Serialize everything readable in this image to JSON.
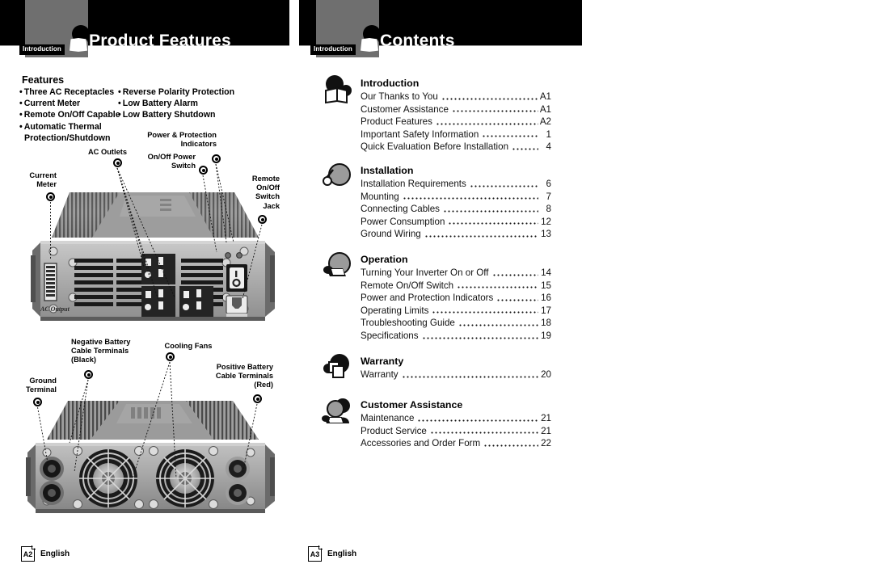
{
  "document": {
    "title": "Product Features / Contents",
    "language": "English"
  },
  "left_page": {
    "header": {
      "tab_label": "Introduction",
      "title": "Product Features",
      "icon": "reader-book-icon"
    },
    "features": {
      "heading": "Features",
      "column_one": [
        "Three AC Receptacles",
        "Current Meter",
        "Remote On/Off Capable",
        "Automatic Thermal"
      ],
      "column_one_continuation": "Protection/Shutdown",
      "column_two": [
        "Reverse Polarity Protection",
        "Low Battery Alarm",
        "Low Battery Shutdown"
      ]
    },
    "front_photo": {
      "caption_alt": "Inverter front panel",
      "panel_label": "AC Output",
      "callouts": [
        {
          "name": "current-meter",
          "lines": [
            "Current",
            "Meter"
          ]
        },
        {
          "name": "ac-outlets",
          "lines": [
            "AC Outlets"
          ]
        },
        {
          "name": "on-off-power-switch",
          "lines": [
            "On/Off Power",
            "Switch"
          ]
        },
        {
          "name": "power-protection-indicators",
          "lines": [
            "Power & Protection",
            "Indicators"
          ]
        },
        {
          "name": "remote-on-off-switch-jack",
          "lines": [
            "Remote",
            "On/Off",
            "Switch",
            "Jack"
          ]
        }
      ]
    },
    "rear_photo": {
      "caption_alt": "Inverter rear panel",
      "callouts": [
        {
          "name": "ground-terminal",
          "lines": [
            "Ground",
            "Terminal"
          ]
        },
        {
          "name": "negative-battery-cable-terminals",
          "lines": [
            "Negative Battery",
            "Cable Terminals",
            "(Black)"
          ]
        },
        {
          "name": "cooling-fans",
          "lines": [
            "Cooling Fans"
          ]
        },
        {
          "name": "positive-battery-cable-terminals",
          "lines": [
            "Positive Battery",
            "Cable Terminals",
            "(Red)"
          ]
        }
      ]
    },
    "footer": {
      "page": "A2",
      "language": "English"
    }
  },
  "right_page": {
    "header": {
      "tab_label": "Introduction",
      "title": "Contents",
      "icon": "reader-book-icon"
    },
    "sections": [
      {
        "heading": "Introduction",
        "icon": "reader-book-icon",
        "entries": [
          {
            "title": "Our Thanks to You",
            "page": "A1"
          },
          {
            "title": "Customer Assistance",
            "page": "A1"
          },
          {
            "title": "Product Features",
            "page": "A2"
          },
          {
            "title": "Important Safety Information",
            "page": "1"
          },
          {
            "title": "Quick Evaluation Before Installation",
            "page": "4"
          }
        ]
      },
      {
        "heading": "Installation",
        "icon": "wrench-circle-icon",
        "entries": [
          {
            "title": "Installation Requirements",
            "page": "6"
          },
          {
            "title": "Mounting",
            "page": "7"
          },
          {
            "title": "Connecting Cables",
            "page": "8"
          },
          {
            "title": "Power Consumption",
            "page": "12"
          },
          {
            "title": "Ground Wiring",
            "page": "13"
          }
        ]
      },
      {
        "heading": "Operation",
        "icon": "hand-switch-icon",
        "entries": [
          {
            "title": "Turning Your Inverter On or Off",
            "page": "14"
          },
          {
            "title": "Remote On/Off Switch",
            "page": "15"
          },
          {
            "title": "Power and Protection Indicators",
            "page": "16"
          },
          {
            "title": "Operating Limits",
            "page": "17"
          },
          {
            "title": "Troubleshooting Guide",
            "page": "18"
          },
          {
            "title": "Specifications",
            "page": "19"
          }
        ]
      },
      {
        "heading": "Warranty",
        "icon": "document-circle-icon",
        "entries": [
          {
            "title": "Warranty",
            "page": "20"
          }
        ]
      },
      {
        "heading": "Customer Assistance",
        "icon": "two-people-icon",
        "entries": [
          {
            "title": "Maintenance",
            "page": "21"
          },
          {
            "title": "Product Service",
            "page": "21"
          },
          {
            "title": "Accessories and Order Form",
            "page": "22"
          }
        ]
      }
    ],
    "footer": {
      "page": "A3",
      "language": "English"
    }
  },
  "colors": {
    "header_band": "#000000",
    "tab_gray": "#6f6f6f",
    "text": "#000000",
    "paper": "#ffffff"
  }
}
